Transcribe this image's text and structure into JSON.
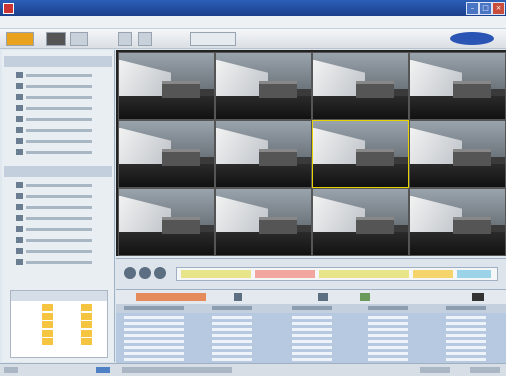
{
  "window": {
    "title": "",
    "controls": [
      "minimize",
      "maximize",
      "close"
    ]
  },
  "menu": {
    "items": [
      "",
      "",
      "",
      "",
      ""
    ]
  },
  "toolbar": {
    "buttons": [
      "toolbar-button-1",
      "toolbar-button-2",
      "toolbar-button-3",
      "toolbar-button-4",
      "toolbar-button-5",
      "toolbar-button-6"
    ]
  },
  "brand": {
    "logo_text": ""
  },
  "sidebar": {
    "groups": [
      {
        "label": "",
        "items": [
          "",
          "",
          "",
          "",
          "",
          "",
          "",
          "",
          ""
        ]
      },
      {
        "label": "",
        "items": [
          "",
          "",
          "",
          "",
          "",
          "",
          "",
          ""
        ]
      }
    ]
  },
  "calendar": {
    "header": "",
    "highlighted_color": "#f5c542"
  },
  "camera_grid": {
    "rows": 3,
    "columns": 4,
    "selected_tile": 6
  },
  "colors": {
    "titlebar": "#1b3f8c",
    "selection_border": "#e6d200",
    "timeline_segments": [
      "#e7e48a",
      "#f1a6a0",
      "#f5d46b",
      "#9bd3e9"
    ]
  }
}
